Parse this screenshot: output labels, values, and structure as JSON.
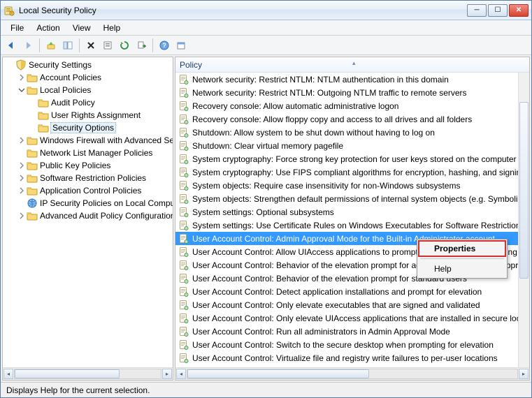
{
  "window": {
    "title": "Local Security Policy"
  },
  "menubar": [
    "File",
    "Action",
    "View",
    "Help"
  ],
  "toolbar_icons": [
    "back-icon",
    "forward-icon",
    "sep",
    "up-icon",
    "show-hide-tree-icon",
    "sep",
    "delete-icon",
    "properties-icon",
    "refresh-icon",
    "export-icon",
    "sep",
    "help-icon",
    "calendar-icon"
  ],
  "tree_root": {
    "label": "Security Settings",
    "children": [
      {
        "label": "Account Policies",
        "expander": "collapsed",
        "depth": 1,
        "icon": "folder"
      },
      {
        "label": "Local Policies",
        "expander": "expanded",
        "depth": 1,
        "icon": "folder",
        "children": [
          {
            "label": "Audit Policy",
            "depth": 2,
            "icon": "folder"
          },
          {
            "label": "User Rights Assignment",
            "depth": 2,
            "icon": "folder"
          },
          {
            "label": "Security Options",
            "depth": 2,
            "icon": "folder",
            "selected": true
          }
        ]
      },
      {
        "label": "Windows Firewall with Advanced Security",
        "expander": "collapsed",
        "depth": 1,
        "icon": "folder"
      },
      {
        "label": "Network List Manager Policies",
        "depth": 1,
        "icon": "folder"
      },
      {
        "label": "Public Key Policies",
        "expander": "collapsed",
        "depth": 1,
        "icon": "folder"
      },
      {
        "label": "Software Restriction Policies",
        "expander": "collapsed",
        "depth": 1,
        "icon": "folder"
      },
      {
        "label": "Application Control Policies",
        "expander": "collapsed",
        "depth": 1,
        "icon": "folder"
      },
      {
        "label": "IP Security Policies on Local Computer",
        "depth": 1,
        "icon": "ipsec"
      },
      {
        "label": "Advanced Audit Policy Configuration",
        "expander": "collapsed",
        "depth": 1,
        "icon": "folder"
      }
    ]
  },
  "list": {
    "header": "Policy",
    "items": [
      {
        "label": "Network security: Restrict NTLM: NTLM authentication in this domain"
      },
      {
        "label": "Network security: Restrict NTLM: Outgoing NTLM traffic to remote servers"
      },
      {
        "label": "Recovery console: Allow automatic administrative logon"
      },
      {
        "label": "Recovery console: Allow floppy copy and access to all drives and all folders"
      },
      {
        "label": "Shutdown: Allow system to be shut down without having to log on"
      },
      {
        "label": "Shutdown: Clear virtual memory pagefile"
      },
      {
        "label": "System cryptography: Force strong key protection for user keys stored on the computer"
      },
      {
        "label": "System cryptography: Use FIPS compliant algorithms for encryption, hashing, and signing"
      },
      {
        "label": "System objects: Require case insensitivity for non-Windows subsystems"
      },
      {
        "label": "System objects: Strengthen default permissions of internal system objects (e.g. Symbolic Links)"
      },
      {
        "label": "System settings: Optional subsystems"
      },
      {
        "label": "System settings: Use Certificate Rules on Windows Executables for Software Restriction Policies"
      },
      {
        "label": "User Account Control: Admin Approval Mode for the Built-in Administrator account",
        "selected": true
      },
      {
        "label": "User Account Control: Allow UIAccess applications to prompt for elevation without using the secure desktop"
      },
      {
        "label": "User Account Control: Behavior of the elevation prompt for administrators in Admin Approval Mode"
      },
      {
        "label": "User Account Control: Behavior of the elevation prompt for standard users"
      },
      {
        "label": "User Account Control: Detect application installations and prompt for elevation"
      },
      {
        "label": "User Account Control: Only elevate executables that are signed and validated"
      },
      {
        "label": "User Account Control: Only elevate UIAccess applications that are installed in secure locations"
      },
      {
        "label": "User Account Control: Run all administrators in Admin Approval Mode"
      },
      {
        "label": "User Account Control: Switch to the secure desktop when prompting for elevation"
      },
      {
        "label": "User Account Control: Virtualize file and registry write failures to per-user locations"
      }
    ]
  },
  "context_menu": {
    "items": [
      {
        "label": "Properties",
        "highlight": true
      },
      {
        "label": "Help"
      }
    ]
  },
  "statusbar": "Displays Help for the current selection."
}
